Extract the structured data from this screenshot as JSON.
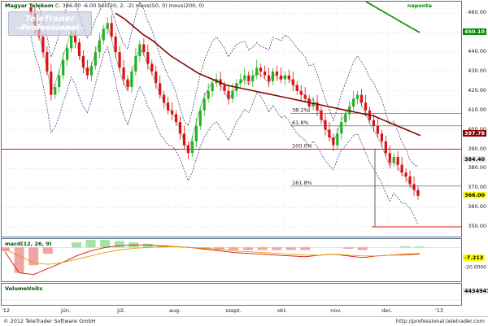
{
  "header": {
    "symbol": "Magyar Telekom",
    "quote": "C: 366.00 -6.00",
    "indicators": "boll(20, 2, -2)  movs(50, 0)  movs(200, 0)",
    "period": "naponta"
  },
  "logo": {
    "title": "TeleTrader Professional",
    "url": "http://professional.teletrader.com"
  },
  "footer": {
    "left": "© 2012 TeleTrader Software GmbH",
    "right": "http://professional.teletrader.com"
  },
  "macd": {
    "label": "macd(12, 26, 9)",
    "value_tag": "-7.213",
    "tick": "-20.0000"
  },
  "volume": {
    "label": "VolumeUnits",
    "value_tag": "4434947"
  },
  "x_labels": [
    "'12",
    "jún.",
    "júl.",
    "aug.",
    "szept.",
    "okt.",
    "nov.",
    "dec.",
    "'13"
  ],
  "colors": {
    "up": "#22b322",
    "down": "#dd1111",
    "ma50": "#8b0000",
    "ma200": "#008a00",
    "boll": "#40407a",
    "hline": "#dd1111"
  },
  "chart_data": {
    "type": "candlestick",
    "title": "Magyar Telekom",
    "ylim": [
      345,
      466
    ],
    "y_ticks": [
      350,
      360,
      370,
      380,
      390,
      400,
      410,
      420,
      430,
      440,
      450,
      460
    ],
    "price_tags": [
      {
        "value": 450.1,
        "label": "450.10",
        "color": "#008a00",
        "text": "#ffffff"
      },
      {
        "value": 397.78,
        "label": "397.78",
        "color": "#8b0000",
        "text": "#ffffff"
      },
      {
        "value": 384.4,
        "label": "384.40",
        "color": "#e8e8e8",
        "text": "#000000"
      },
      {
        "value": 366.0,
        "label": "366.00",
        "color": "#ffff00",
        "text": "#000000"
      }
    ],
    "horizontal_lines": [
      390.0,
      350.0
    ],
    "fibonacci": [
      {
        "label": "38.2%",
        "value": 408.5
      },
      {
        "label": "61.8%",
        "value": 402.0
      },
      {
        "label": "100.0%",
        "value": 390.0
      },
      {
        "label": "161.8%",
        "value": 371.0
      }
    ],
    "candle_closes": [
      460,
      452,
      448,
      440,
      430,
      418,
      422,
      428,
      436,
      442,
      449,
      445,
      438,
      432,
      428,
      433,
      440,
      446,
      452,
      455,
      448,
      440,
      432,
      426,
      422,
      430,
      438,
      444,
      440,
      434,
      430,
      424,
      418,
      414,
      410,
      408,
      404,
      398,
      392,
      388,
      394,
      402,
      410,
      416,
      420,
      424,
      426,
      423,
      420,
      416,
      420,
      424,
      426,
      428,
      425,
      428,
      432,
      430,
      428,
      425,
      430,
      428,
      426,
      428,
      426,
      423,
      420,
      418,
      416,
      412,
      414,
      410,
      405,
      400,
      396,
      392,
      398,
      404,
      408,
      412,
      416,
      418,
      414,
      410,
      405,
      402,
      398,
      394,
      388,
      383,
      386,
      382,
      378,
      376,
      372,
      369,
      366
    ],
    "ma50": [
      460,
      457,
      453,
      449,
      446,
      442,
      438,
      435,
      432,
      429,
      427,
      425,
      423,
      422,
      421,
      420,
      419,
      418,
      417,
      416,
      415,
      414,
      413,
      412,
      411,
      410,
      409,
      408,
      407,
      405,
      403,
      401,
      399,
      397
    ],
    "ma200_segment": [
      466,
      462,
      458,
      454,
      450.1
    ],
    "macd_series": [
      -5,
      -30,
      -32,
      -25,
      -18,
      -10,
      -4,
      0,
      2,
      3,
      3,
      2,
      1,
      0,
      -2,
      -4,
      -6,
      -7,
      -8,
      -9,
      -10,
      -11,
      -9,
      -8,
      -10,
      -12,
      -10,
      -9,
      -8,
      -7.2
    ],
    "macd_signal": [
      -2,
      -10,
      -18,
      -20,
      -18,
      -14,
      -10,
      -6,
      -3,
      -1,
      0,
      1,
      1,
      0,
      -1,
      -2,
      -4,
      -5,
      -6,
      -7,
      -8,
      -9,
      -9,
      -8,
      -9,
      -10,
      -10,
      -9,
      -9,
      -8
    ]
  }
}
